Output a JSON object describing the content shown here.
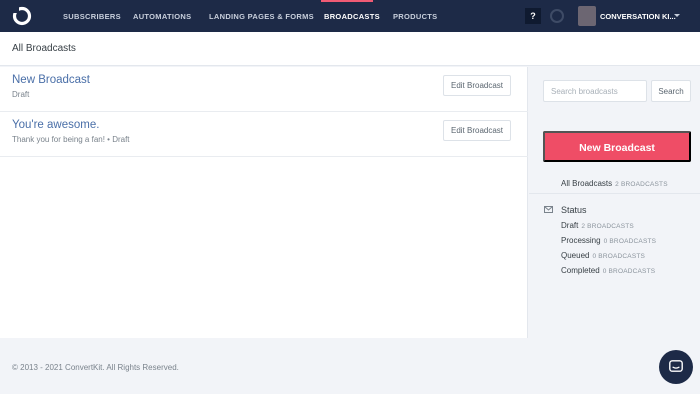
{
  "nav": {
    "items": [
      {
        "label": "SUBSCRIBERS",
        "active": false
      },
      {
        "label": "AUTOMATIONS",
        "active": false
      },
      {
        "label": "LANDING PAGES & FORMS",
        "active": false
      },
      {
        "label": "BROADCASTS",
        "active": true
      },
      {
        "label": "PRODUCTS",
        "active": false
      }
    ],
    "help_label": "?",
    "account_name": "CONVERSATION KI...",
    "accent_color": "#ef5b74",
    "background_color": "#1d2a47"
  },
  "page": {
    "title": "All Broadcasts"
  },
  "broadcasts": [
    {
      "title": "New Broadcast",
      "subtitle": "Draft",
      "action_label": "Edit Broadcast"
    },
    {
      "title": "You're awesome.",
      "subtitle": "Thank you for being a fan! • Draft",
      "action_label": "Edit Broadcast"
    }
  ],
  "sidebar": {
    "search_placeholder": "Search broadcasts",
    "search_value": "",
    "search_button_label": "Search",
    "new_button_label": "New Broadcast",
    "new_button_color": "#ef4d66",
    "all_label": "All Broadcasts",
    "all_count": "2 BROADCASTS",
    "status_heading": "Status",
    "statuses": [
      {
        "label": "Draft",
        "count": "2 BROADCASTS"
      },
      {
        "label": "Processing",
        "count": "0 BROADCASTS"
      },
      {
        "label": "Queued",
        "count": "0 BROADCASTS"
      },
      {
        "label": "Completed",
        "count": "0 BROADCASTS"
      }
    ]
  },
  "footer": {
    "copyright": "© 2013 - 2021 ConvertKit. All Rights Reserved."
  },
  "icons": {
    "logo": "convertkit-logo-icon",
    "loading": "spinner-icon",
    "status": "envelope-icon",
    "chat": "chat-icon"
  }
}
